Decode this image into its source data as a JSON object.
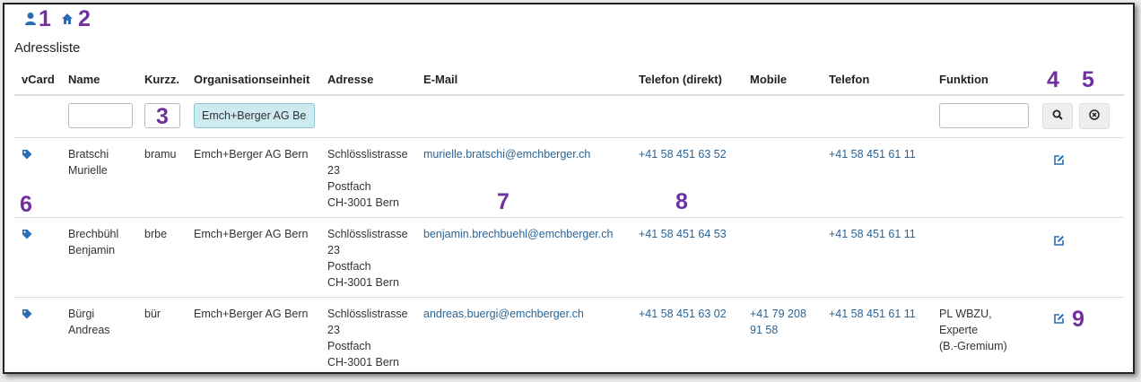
{
  "page": {
    "title": "Adressliste"
  },
  "annotations": [
    "1",
    "2",
    "3",
    "4",
    "5",
    "6",
    "7",
    "8",
    "9"
  ],
  "table": {
    "columns": [
      "vCard",
      "Name",
      "Kurzz.",
      "Organisationseinheit",
      "Adresse",
      "E-Mail",
      "Telefon (direkt)",
      "Mobile",
      "Telefon",
      "Funktion"
    ],
    "filters": {
      "name": "",
      "kurzz": "",
      "organisationseinheit": "Emch+Berger AG Bern",
      "funktion": ""
    },
    "rows": [
      {
        "name_line1": "Bratschi",
        "name_line2": "Murielle",
        "kurzz": "bramu",
        "org": "Emch+Berger AG Bern",
        "address": [
          "Schlösslistrasse",
          "23",
          "Postfach",
          "CH-3001 Bern"
        ],
        "email": "murielle.bratschi@emchberger.ch",
        "phone_direct": "+41 58 451 63 52",
        "mobile_line1": "",
        "mobile_line2": "",
        "phone": "+41 58 451 61 11",
        "function": [
          "",
          "",
          ""
        ]
      },
      {
        "name_line1": "Brechbühl",
        "name_line2": "Benjamin",
        "kurzz": "brbe",
        "org": "Emch+Berger AG Bern",
        "address": [
          "Schlösslistrasse",
          "23",
          "Postfach",
          "CH-3001 Bern"
        ],
        "email": "benjamin.brechbuehl@emchberger.ch",
        "phone_direct": "+41 58 451 64 53",
        "mobile_line1": "",
        "mobile_line2": "",
        "phone": "+41 58 451 61 11",
        "function": [
          "",
          "",
          ""
        ]
      },
      {
        "name_line1": "Bürgi",
        "name_line2": "Andreas",
        "kurzz": "bür",
        "org": "Emch+Berger AG Bern",
        "address": [
          "Schlösslistrasse",
          "23",
          "Postfach",
          "CH-3001 Bern"
        ],
        "email": "andreas.buergi@emchberger.ch",
        "phone_direct": "+41 58 451 63 02",
        "mobile_line1": "+41 79 208",
        "mobile_line2": "91 58",
        "phone": "+41 58 451 61 11",
        "function": [
          "PL WBZU,",
          "Experte",
          "(B.-Gremium)"
        ]
      }
    ]
  },
  "icons": {
    "user": "user-icon",
    "home": "home-icon",
    "search": "search-icon",
    "reset": "reset-icon",
    "vcard": "tag-icon",
    "edit": "edit-icon"
  },
  "colors": {
    "link": "#2a6496",
    "annotation": "#7030a0",
    "filter_active": "#cdeaf0"
  }
}
